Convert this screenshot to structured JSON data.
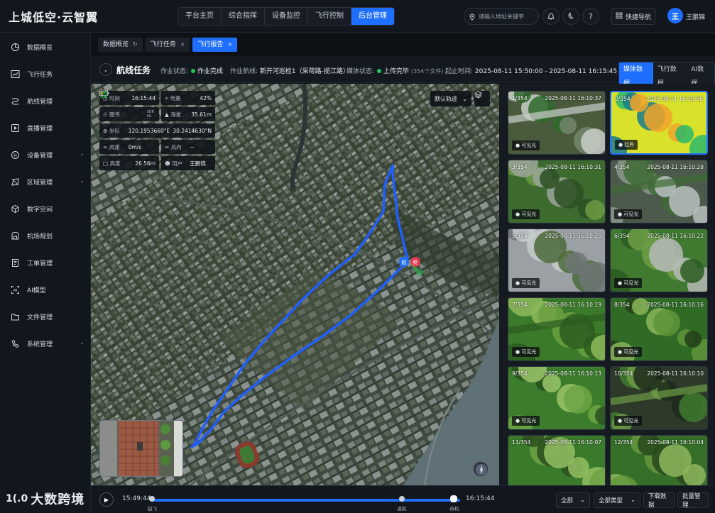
{
  "app": {
    "brand": "上城低空·云智翼"
  },
  "topnav": [
    {
      "label": "平台主页",
      "active": false
    },
    {
      "label": "综合指挥",
      "active": false
    },
    {
      "label": "设备监控",
      "active": false
    },
    {
      "label": "飞行控制",
      "active": false
    },
    {
      "label": "后台管理",
      "active": true
    }
  ],
  "search": {
    "placeholder": "请输入地址关键字"
  },
  "header": {
    "quick_nav": "快捷导航",
    "avatar_initial": "王",
    "username": "王鹏锦"
  },
  "sidebar": {
    "items": [
      {
        "label": "数据概览",
        "icon": "pie-chart-icon",
        "expandable": false
      },
      {
        "label": "飞行任务",
        "icon": "line-chart-icon",
        "expandable": false
      },
      {
        "label": "航线管理",
        "icon": "route-icon",
        "expandable": false
      },
      {
        "label": "直播管理",
        "icon": "play-square-icon",
        "expandable": false
      },
      {
        "label": "设备管理",
        "icon": "hub-icon",
        "expandable": true
      },
      {
        "label": "区域管理",
        "icon": "area-icon",
        "expandable": true
      },
      {
        "label": "数字空间",
        "icon": "cube-icon",
        "expandable": false
      },
      {
        "label": "机场规划",
        "icon": "airport-icon",
        "expandable": false
      },
      {
        "label": "工单管理",
        "icon": "ticket-icon",
        "expandable": false
      },
      {
        "label": "AI模型",
        "icon": "ai-icon",
        "expandable": false
      },
      {
        "label": "文件管理",
        "icon": "folder-icon",
        "expandable": false
      },
      {
        "label": "系统管理",
        "icon": "org-icon",
        "expandable": true
      }
    ]
  },
  "tabs": [
    {
      "label": "数据概览",
      "active": false,
      "closable": false
    },
    {
      "label": "飞行任务",
      "active": false,
      "closable": true
    },
    {
      "label": "飞行报告",
      "active": true,
      "closable": true
    }
  ],
  "task": {
    "title": "航线任务",
    "status_label": "作业状态:",
    "status_value": "作业完成",
    "route_label": "作业航线:",
    "route_value": "新开河巡检1（采荷路-揽江路）",
    "media_label": "媒体状态:",
    "media_value": "上传完毕",
    "media_count": "(354个文件)",
    "time_label": "起止时间:",
    "time_value": "2025-08-11 15:50:00 - 2025-08-11 16:15:45",
    "view_tabs": [
      {
        "label": "媒体数据",
        "active": true
      },
      {
        "label": "飞行数据",
        "active": false
      },
      {
        "label": "AI数据",
        "active": false
      }
    ]
  },
  "telemetry": {
    "time_label": "时间",
    "time_value": "16:15:44",
    "battery_label": "电量",
    "battery_value": "42%",
    "battery_level": 0.42,
    "signal_label": "图传",
    "signal_sdr": "SDR",
    "signal_4g": "4G",
    "altitude_label": "海拔",
    "altitude_value": "35.61m",
    "coord_label": "坐标",
    "coord_lon": "120.1953660°E",
    "coord_lat": "30.2414630°N",
    "wind_label": "风速",
    "wind_value": "0m/s",
    "wind_dir_label": "风向",
    "wind_dir_value": "--",
    "height_label": "高度",
    "height_value": "26.56m",
    "user_label": "用户",
    "user_value": "王鹏锦"
  },
  "map": {
    "track_mode": "默认轨迹",
    "start_marker": "起",
    "end_marker": "终",
    "route_color": "#1f5fff"
  },
  "gallery": {
    "items": [
      {
        "index": "1/354",
        "time": "2025-08-11 16:10:37",
        "tag": "可见光",
        "selected": false,
        "palette": [
          "#4a5a3c",
          "#73866b",
          "#c8cec9",
          "#2f6a2b"
        ]
      },
      {
        "index": "2/354",
        "time": "2025-08-11 16:10:56",
        "tag": "红外",
        "selected": true,
        "palette": [
          "#d8e22a",
          "#2bb86a",
          "#1b7a8c",
          "#f2a32a"
        ]
      },
      {
        "index": "3/354",
        "time": "2025-08-11 16:10:31",
        "tag": "可见光",
        "selected": false,
        "palette": [
          "#3d6b2e",
          "#6c9a43",
          "#9aa49a",
          "#2c4f22"
        ]
      },
      {
        "index": "4/354",
        "time": "2025-08-11 16:10:28",
        "tag": "可见光",
        "selected": false,
        "palette": [
          "#4b5a4a",
          "#8a9a8a",
          "#3f6b35",
          "#b9c0bf"
        ]
      },
      {
        "index": "5/354",
        "time": "2025-08-11 16:10:25",
        "tag": "可见光",
        "selected": false,
        "palette": [
          "#9aa0a3",
          "#c7cbcd",
          "#4b6a3b",
          "#6f7577"
        ]
      },
      {
        "index": "6/354",
        "time": "2025-08-11 16:10:22",
        "tag": "可见光",
        "selected": false,
        "palette": [
          "#3f7a30",
          "#6f9e45",
          "#b6bab8",
          "#2b5a20"
        ]
      },
      {
        "index": "7/354",
        "time": "2025-08-11 16:10:19",
        "tag": "可见光",
        "selected": false,
        "palette": [
          "#3a7a2a",
          "#6ba040",
          "#2c5c1f",
          "#8fba5c"
        ]
      },
      {
        "index": "8/354",
        "time": "2025-08-11 16:10:16",
        "tag": "可见光",
        "selected": false,
        "palette": [
          "#2f6b24",
          "#5f943a",
          "#233f1a",
          "#8ab55a"
        ]
      },
      {
        "index": "9/354",
        "time": "2025-08-11 16:10:13",
        "tag": "可见光",
        "selected": false,
        "palette": [
          "#3b7d2c",
          "#6fa444",
          "#294f1d",
          "#9cc46a"
        ]
      },
      {
        "index": "10/354",
        "time": "2025-08-11 16:10:10",
        "tag": "可见光",
        "selected": false,
        "palette": [
          "#2d3a2a",
          "#3f7a2e",
          "#6c9a44",
          "#1d2a1b"
        ]
      },
      {
        "index": "11/354",
        "time": "2025-08-11 16:10:07",
        "tag": "",
        "selected": false,
        "palette": [
          "#3a7a2b",
          "#6ea345",
          "#2a4f1e",
          "#94be62"
        ]
      },
      {
        "index": "12/354",
        "time": "2025-08-11 16:10:04",
        "tag": "",
        "selected": false,
        "palette": [
          "#356f28",
          "#65983d",
          "#27481c",
          "#8eb65c"
        ]
      }
    ]
  },
  "playback": {
    "start_time": "15:49:44",
    "end_time": "16:15:44",
    "progress": 1.0,
    "phases": [
      {
        "label": "起飞",
        "position": 0.0
      },
      {
        "label": "返航",
        "position": 0.81
      },
      {
        "label": "待机",
        "position": 0.98
      }
    ]
  },
  "filters": {
    "all_label": "全部",
    "all_types_label": "全部类型",
    "download_label": "下载数据",
    "batch_label": "批量管理"
  },
  "watermark": {
    "text": "大数跨境",
    "logo_text": "1(.0"
  }
}
